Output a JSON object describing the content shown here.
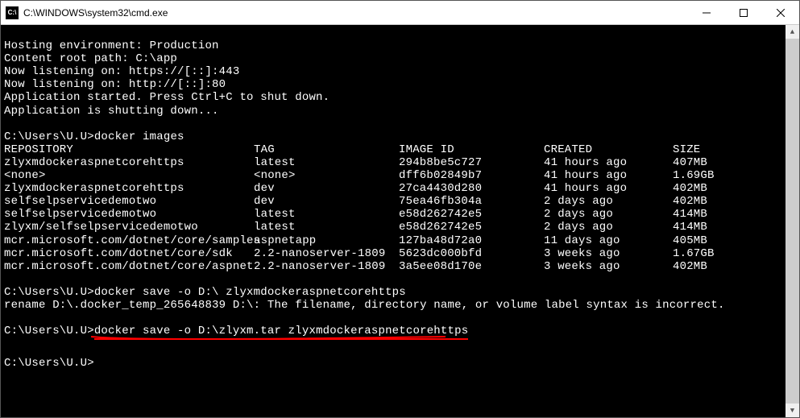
{
  "window": {
    "title": "C:\\WINDOWS\\system32\\cmd.exe"
  },
  "output": {
    "line1": "Hosting environment: Production",
    "line2": "Content root path: C:\\app",
    "line3": "Now listening on: https://[::]:443",
    "line4": "Now listening on: http://[::]:80",
    "line5": "Application started. Press Ctrl+C to shut down.",
    "line6": "Application is shutting down..."
  },
  "prompt1": "C:\\Users\\U.U>",
  "cmd1": "docker images",
  "table": {
    "header": {
      "repo": "REPOSITORY",
      "tag": "TAG",
      "img": "IMAGE ID",
      "crt": "CREATED",
      "size": "SIZE"
    },
    "rows": [
      {
        "repo": "zlyxmdockeraspnetcorehttps",
        "tag": "latest",
        "img": "294b8be5c727",
        "crt": "41 hours ago",
        "size": "407MB"
      },
      {
        "repo": "<none>",
        "tag": "<none>",
        "img": "dff6b02849b7",
        "crt": "41 hours ago",
        "size": "1.69GB"
      },
      {
        "repo": "zlyxmdockeraspnetcorehttps",
        "tag": "dev",
        "img": "27ca4430d280",
        "crt": "41 hours ago",
        "size": "402MB"
      },
      {
        "repo": "selfselpservicedemotwo",
        "tag": "dev",
        "img": "75ea46fb304a",
        "crt": "2 days ago",
        "size": "402MB"
      },
      {
        "repo": "selfselpservicedemotwo",
        "tag": "latest",
        "img": "e58d262742e5",
        "crt": "2 days ago",
        "size": "414MB"
      },
      {
        "repo": "zlyxm/selfselpservicedemotwo",
        "tag": "latest",
        "img": "e58d262742e5",
        "crt": "2 days ago",
        "size": "414MB"
      },
      {
        "repo": "mcr.microsoft.com/dotnet/core/samples",
        "tag": "aspnetapp",
        "img": "127ba48d72a0",
        "crt": "11 days ago",
        "size": "405MB"
      },
      {
        "repo": "mcr.microsoft.com/dotnet/core/sdk",
        "tag": "2.2-nanoserver-1809",
        "img": "5623dc000bfd",
        "crt": "3 weeks ago",
        "size": "1.67GB"
      },
      {
        "repo": "mcr.microsoft.com/dotnet/core/aspnet",
        "tag": "2.2-nanoserver-1809",
        "img": "3a5ee08d170e",
        "crt": "3 weeks ago",
        "size": "402MB"
      }
    ]
  },
  "prompt2": "C:\\Users\\U.U>",
  "cmd2": "docker save -o D:\\ zlyxmdockeraspnetcorehttps",
  "err2": "rename D:\\.docker_temp_265648839 D:\\: The filename, directory name, or volume label syntax is incorrect.",
  "prompt3": "C:\\Users\\U.U>",
  "cmd3": "docker save -o D:\\zlyxm.tar zlyxmdockeraspnetcorehttps",
  "prompt4": "C:\\Users\\U.U>"
}
